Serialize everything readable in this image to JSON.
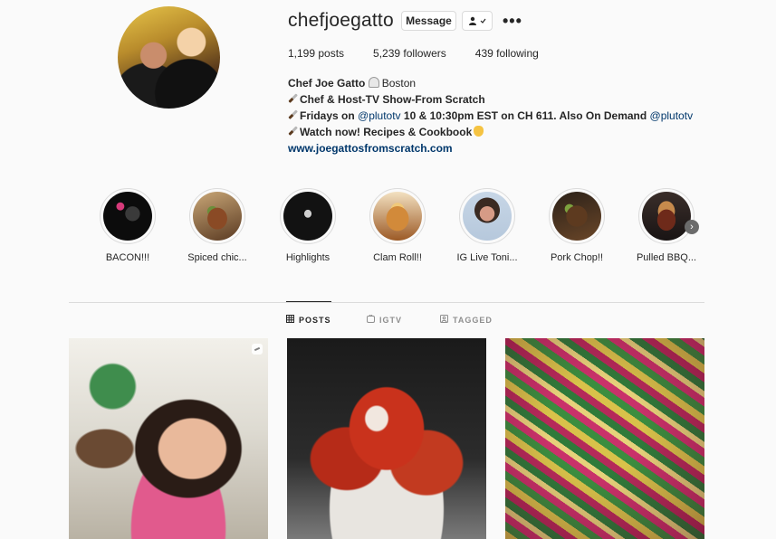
{
  "profile": {
    "username": "chefjoegatto",
    "message_label": "Message",
    "follow_icon": "person-check-icon",
    "more_label": "•••",
    "stats": {
      "posts": "1,199 posts",
      "followers": "5,239 followers",
      "following": "439 following"
    },
    "bio": {
      "name": "Chef Joe Gatto",
      "location": "Boston",
      "line1": "Chef & Host-TV Show-From Scratch",
      "line2_prefix": "Fridays on ",
      "line2_handle": "@plutotv",
      "line2_middle": " 10 & 10:30pm EST on CH 611. Also On Demand ",
      "line2_handle2": "@plutotv",
      "line3": "Watch now! Recipes & Cookbook",
      "website": "www.joegattosfromscratch.com"
    }
  },
  "highlights": [
    {
      "label": "BACON!!!",
      "style": "hl-dark"
    },
    {
      "label": "Spiced chic...",
      "style": "hl-meat"
    },
    {
      "label": "Highlights",
      "style": "hl-text"
    },
    {
      "label": "Clam Roll!!",
      "style": "hl-clam"
    },
    {
      "label": "IG Live Toni...",
      "style": "hl-live"
    },
    {
      "label": "Pork Chop!!",
      "style": "hl-pork"
    },
    {
      "label": "Pulled BBQ...",
      "style": "hl-bbq"
    }
  ],
  "tabs": {
    "posts": "POSTS",
    "igtv": "IGTV",
    "tagged": "TAGGED"
  },
  "colors": {
    "link": "#00376b",
    "border": "#dbdbdb",
    "muted": "#8e8e8e"
  }
}
